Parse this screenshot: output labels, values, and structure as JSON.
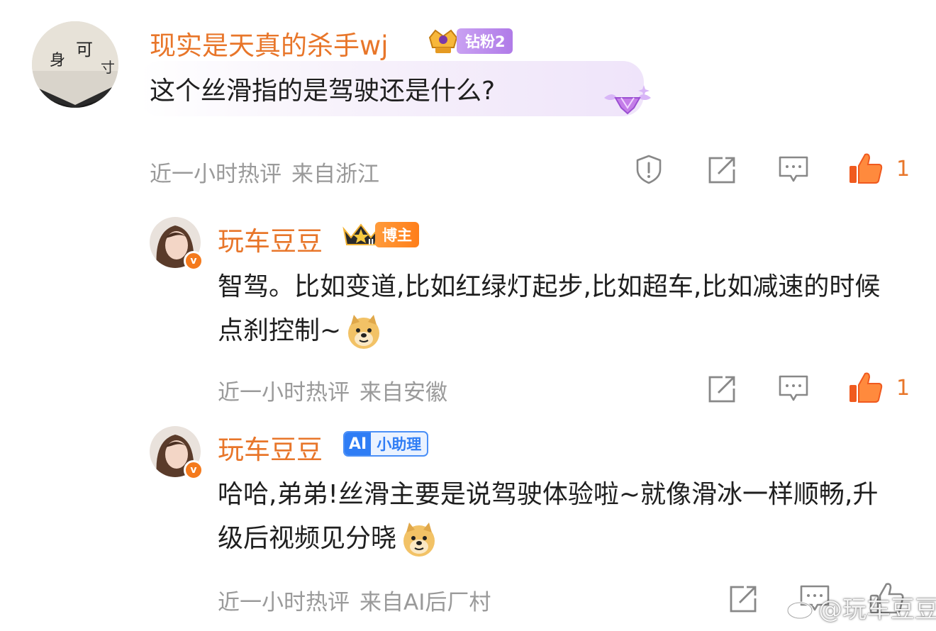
{
  "comments": [
    {
      "username": "现实是天真的杀手wj",
      "badge": "钻粉2",
      "text": "这个丝滑指的是驾驶还是什么?",
      "time": "近一小时热评",
      "location": "来自浙江",
      "likes": "1"
    },
    {
      "username": "玩车豆豆",
      "badge": "博主",
      "text": "智驾。比如变道,比如红绿灯起步,比如超车,比如减速的时候点刹控制~",
      "time": "近一小时热评",
      "location": "来自安徽",
      "likes": "1"
    },
    {
      "username": "玩车豆豆",
      "badge_ai": "AI",
      "badge": "小助理",
      "text": "哈哈,弟弟!丝滑主要是说驾驶体验啦~就像滑冰一样顺畅,升级后视频见分晓",
      "time": "近一小时热评",
      "location": "来自AI后厂村"
    }
  ],
  "watermark": "@玩车豆豆",
  "icons": {
    "report": "report-icon",
    "share": "share-icon",
    "reply": "reply-icon",
    "like": "thumbs-up-icon",
    "emoji": "doge-emoji-icon"
  },
  "colors": {
    "accent": "#e8762a",
    "meta": "#9a9a9a",
    "ai_blue": "#2f7df5"
  }
}
